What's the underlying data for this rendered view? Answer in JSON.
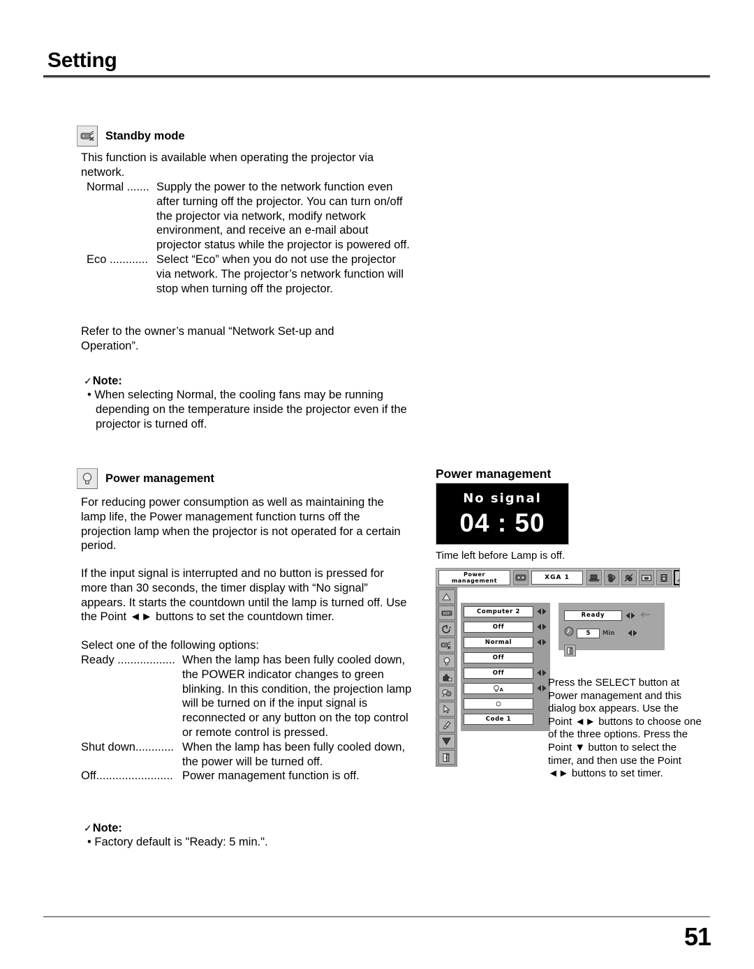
{
  "header": {
    "section_title": "Setting"
  },
  "footer": {
    "page_number": "51"
  },
  "standby": {
    "heading": "Standby mode",
    "icon": "standby-mode-icon",
    "intro": "This function is available when operating the projector via network.",
    "options": [
      {
        "term": "Normal .......",
        "desc": "Supply the power to the network function even after turning off the projector. You can turn on/off the projector via network, modify network environment, and receive an e-mail about projector status while the projector is powered off."
      },
      {
        "term": "Eco ............",
        "desc": "Select “Eco” when you do not use the projector via network. The projector’s network function will stop when turning off the projector."
      }
    ],
    "refer": "Refer to the owner’s manual “Network Set-up and Operation”.",
    "note": {
      "check": "✓",
      "title": "Note:",
      "items": [
        "• When selecting Normal, the cooling fans may be running depending on the temperature inside the projector even if the projector is turned off."
      ]
    }
  },
  "power_management": {
    "heading": "Power management",
    "icon": "lamp-icon",
    "para1": "For reducing power consumption as well as maintaining the lamp life, the Power management function turns off the projection lamp when the projector is not operated for a certain period.",
    "para2": "If the input signal is interrupted and no button is pressed for more than 30 seconds, the timer display with “No signal” appears. It starts the countdown until the lamp is turned off. Use the Point ◄► buttons to set the countdown timer.",
    "select_intro": "Select one of the following options:",
    "options": [
      {
        "term": "Ready ..................",
        "desc": "When the lamp has been fully cooled down, the POWER indicator changes to green blinking. In this condition, the projection lamp will be turned on if the input signal is reconnected or any button on the top control or remote control is pressed."
      },
      {
        "term": "Shut down............",
        "desc": "When the lamp has been fully cooled down, the power will be turned off."
      },
      {
        "term": "Off........................",
        "desc": "Power management function is off."
      }
    ],
    "note": {
      "check": "✓",
      "title": "Note:",
      "items": [
        "• Factory default is \"Ready: 5 min.\"."
      ]
    }
  },
  "figure": {
    "title": "Power management",
    "no_signal_screen": {
      "label": "No signal",
      "time": "04 : 50"
    },
    "caption": "Time left before Lamp is off.",
    "osd": {
      "menu_label_line1": "Power",
      "menu_label_line2": "management",
      "source_icon": "input-source-icon",
      "source_label": "XGA 1",
      "tabs": [
        {
          "name": "computer-tab",
          "selected": false
        },
        {
          "name": "color-adjust-tab",
          "selected": false
        },
        {
          "name": "image-adjust-tab",
          "selected": false
        },
        {
          "name": "screen-tab",
          "selected": false
        },
        {
          "name": "sound-tab",
          "selected": false
        },
        {
          "name": "setting-tab",
          "selected": true
        },
        {
          "name": "information-tab",
          "selected": false
        }
      ],
      "side_icons": [
        "scroll-up-icon",
        "remote-control-icon",
        "power-switch-icon",
        "standby-mode-icon",
        "lamp-icon",
        "key-lock-icon",
        "security-icon",
        "pointer-icon",
        "eraser-icon",
        "scroll-down-icon",
        "exit-icon"
      ],
      "rows": [
        {
          "value": "Computer 2",
          "arrows": true
        },
        {
          "value": "Off",
          "arrows": true
        },
        {
          "value": "Normal",
          "arrows": true
        },
        {
          "value": "Off",
          "arrows": false
        },
        {
          "value": "Off",
          "arrows": true
        },
        {
          "value": "",
          "icon": "lamp-auto-icon",
          "arrows": true
        },
        {
          "value": "",
          "icon": "fan-circle-icon",
          "arrows": false
        },
        {
          "value": "Code 1",
          "arrows": false
        }
      ],
      "dialog": {
        "mode_value": "Ready",
        "mode_arrows": true,
        "pointer_hint": "←",
        "clock_icon": "clock-icon",
        "timer_value": "5",
        "timer_unit": "Min",
        "timer_arrows": true,
        "exit_icon": "exit-icon"
      }
    },
    "description": "Press the SELECT button at Power management and this dialog box appears. Use the Point ◄► buttons to choose one of the three options. Press the Point ▼ button to select the timer, and then use the Point ◄► buttons to set timer."
  }
}
